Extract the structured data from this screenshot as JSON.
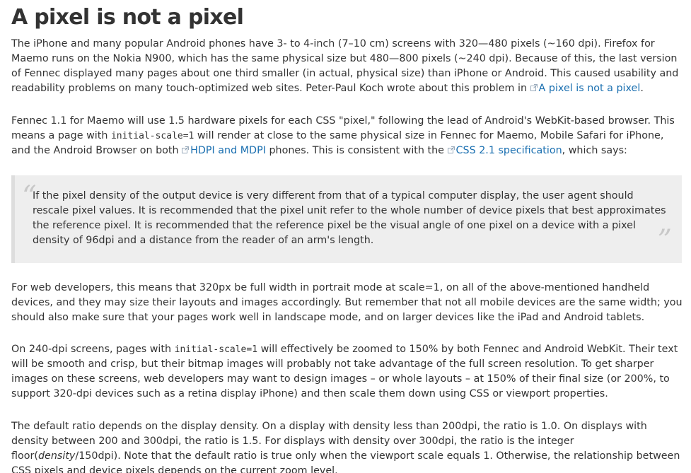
{
  "title": "A pixel is not a pixel",
  "p1": {
    "text": "The iPhone and many popular Android phones have 3- to 4-inch (7–10 cm) screens with 320—480 pixels (~160 dpi). Firefox for Maemo runs on the Nokia N900, which has the same physical size but 480—800 pixels (~240 dpi). Because of this, the last version of Fennec displayed many pages about one third smaller (in actual, physical size) than iPhone or Android. This caused usability and readability problems on many touch-optimized web sites. Peter-Paul Koch wrote about this problem in ",
    "link": "A pixel is not a pixel",
    "end": "."
  },
  "p2": {
    "a": "Fennec 1.1 for Maemo will use 1.5 hardware pixels for each CSS \"pixel,\" following the lead of Android's WebKit-based browser. This means a page with ",
    "code": "initial-scale=1",
    "b": " will render at close to the same physical size in Fennec for Maemo, Mobile Safari for iPhone, and the Android Browser on both ",
    "link1": "HDPI and MDPI",
    "c": " phones. This is consistent with the ",
    "link2": "CSS 2.1 specification",
    "d": ", which says:"
  },
  "quote": {
    "open_mark": "“",
    "close_mark": "”",
    "text": "If the pixel density of the output device is very different from that of a typical computer display, the user agent should rescale pixel values. It is recommended that the pixel unit refer to the whole number of device pixels that best approximates the reference pixel. It is recommended that the reference pixel be the visual angle of one pixel on a device with a pixel density of 96dpi and a distance from the reader of an arm's length."
  },
  "p3": "For web developers, this means that 320px be full width in portrait mode at scale=1, on all of the above-mentioned handheld devices, and they may size their layouts and images accordingly. But remember that not all mobile devices are the same width; you should also make sure that your pages work well in landscape mode, and on larger devices like the iPad and Android tablets.",
  "p4": {
    "a": "On 240-dpi screens, pages with ",
    "code": "initial-scale=1",
    "b": " will effectively be zoomed to 150% by both Fennec and Android WebKit. Their text will be smooth and crisp, but their bitmap images will probably not take advantage of the full screen resolution. To get sharper images on these screens, web developers may want to design images – or whole layouts – at 150% of their final size (or 200%, to support 320-dpi devices such as a retina display iPhone) and then scale them down using CSS or viewport properties."
  },
  "p5": {
    "a": "The default ratio depends on the display density.  On a display with density less than 200dpi, the ratio is 1.0.  On displays with density between 200 and 300dpi, the ratio is 1.5.  For displays with density over 300dpi, the ratio is the integer floor(",
    "em": "density",
    "b": "/150dpi).  Note that the default ratio is true only when the viewport scale equals 1. Otherwise, the relationship between CSS pixels and device pixels depends on the current zoom level."
  },
  "icons": {
    "external_link": "external-link-icon"
  },
  "colors": {
    "link": "#1a6fb0",
    "text": "#333333",
    "quote_bg": "#eeeeee",
    "quote_mark": "#c8c8c8"
  }
}
